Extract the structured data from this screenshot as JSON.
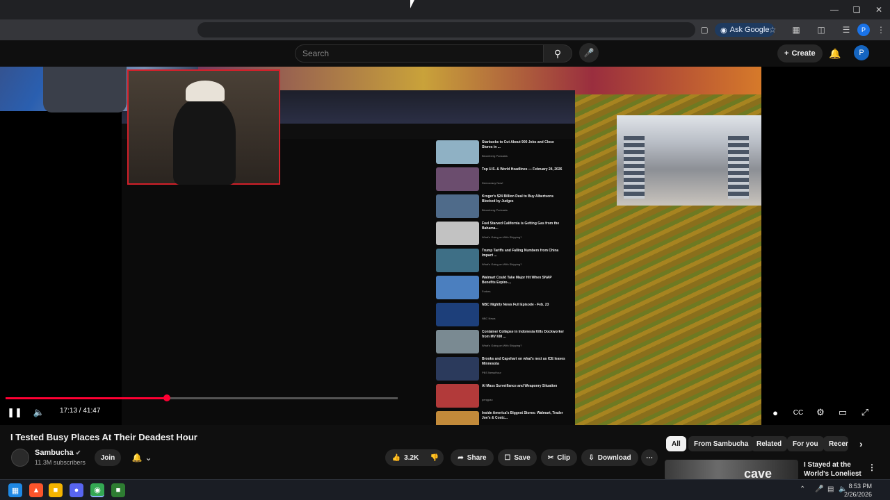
{
  "browser": {
    "ask_google_label": "Ask Google",
    "profile_initial": "P"
  },
  "masthead": {
    "search_placeholder": "Search",
    "create_label": "Create",
    "avatar_initial": "P"
  },
  "player": {
    "current_time": "17:13",
    "duration": "41:47",
    "time_display": "17:13 / 41:47",
    "progress_fraction": 0.412,
    "buffered_fraction": 0.99
  },
  "inner_sidebar": [
    {
      "title": "Starbucks to Cut About 900 Jobs and Close Stores in ...",
      "meta": "Bloomberg Podcasts",
      "thumb": "#8fb1c4"
    },
    {
      "title": "Top U.S. & World Headlines — February 24, 2026",
      "meta": "Democracy Now!",
      "thumb": "#6b4d6e"
    },
    {
      "title": "Kroger's $24 Billion Deal to Buy Albertsons Blocked by Judges",
      "meta": "Bloomberg Podcasts",
      "thumb": "#4f6b8a"
    },
    {
      "title": "Fuel Starved California is Getting Gas from the Bahama...",
      "meta": "What's Going on With Shipping?",
      "thumb": "#c2c2c2"
    },
    {
      "title": "Trump Tariffs and Falling Numbers from China Impact ...",
      "meta": "What's Going on With Shipping?",
      "thumb": "#3e6f86"
    },
    {
      "title": "Walmart Could Take Major Hit When SNAP Benefits Expire-...",
      "meta": "Forbes",
      "thumb": "#4b7fbf"
    },
    {
      "title": "NBC Nightly News Full Episode - Feb. 23",
      "meta": "NBC News",
      "thumb": "#1d3f7a"
    },
    {
      "title": "Container Collapse in Indonesia Kills Dockworker from MV KM ...",
      "meta": "What's Going on With Shipping?",
      "thumb": "#7a8a92"
    },
    {
      "title": "Brooks and Capehart on what's next as ICE leaves Minnesota",
      "meta": "PBS NewsHour",
      "thumb": "#2b3a5c"
    },
    {
      "title": "AI Mass Surveillance and Weaponry Situation",
      "meta": "pengpao",
      "thumb": "#b23a3a"
    },
    {
      "title": "Inside America's Biggest Stores: Walmart, Trader Joe's & Costc...",
      "meta": "",
      "thumb": "#c28a3a"
    }
  ],
  "video": {
    "title": "I Tested Busy Places At Their Deadest Hour",
    "channel": "Sambucha",
    "subscribers": "11.3M subscribers",
    "join_label": "Join",
    "likes": "3.2K",
    "share_label": "Share",
    "save_label": "Save",
    "clip_label": "Clip",
    "download_label": "Download"
  },
  "chips": [
    "All",
    "From Sambucha",
    "Related",
    "For you",
    "Recer"
  ],
  "recommendation": {
    "title": "I Stayed at the World's Loneliest ...",
    "thumb_word": "cave"
  },
  "taskbar": {
    "time": "8:53 PM",
    "date": "2/26/2026"
  },
  "colors": {
    "youtube_red": "#ff0033",
    "background": "#0f0f0f",
    "facecam_border": "#d3202a"
  }
}
